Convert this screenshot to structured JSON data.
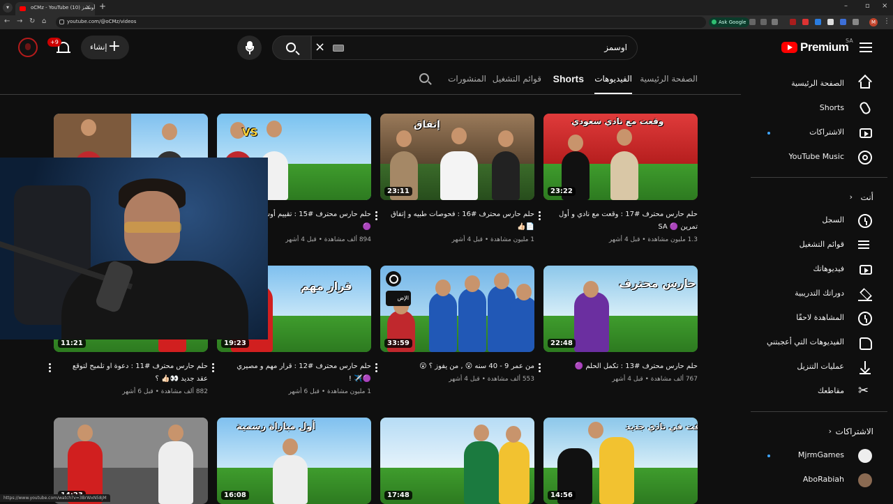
{
  "browser": {
    "tab_title": "oCMz - YouTube أوسمز (10)",
    "url": "youtube.com/@oCMz/videos",
    "ask_google": "Ask Google",
    "profile_initial": "M",
    "status_url": "https://www.youtube.com/watch?v=3BrWxN58jM"
  },
  "header": {
    "logo_word": "Premium",
    "country_code": "SA",
    "search_query": "اوسمز",
    "create_label": "إنشاء",
    "notification_count": "+9"
  },
  "channel_tabs": [
    {
      "label": "الصفحة الرئيسية",
      "active": false
    },
    {
      "label": "الفيديوهات",
      "active": true
    },
    {
      "label": "Shorts",
      "active": false
    },
    {
      "label": "قوائم التشغيل",
      "active": false
    },
    {
      "label": "المنشورات",
      "active": false
    }
  ],
  "sidebar": {
    "main": [
      {
        "label": "الصفحة الرئيسية",
        "icon": "home-icon"
      },
      {
        "label": "Shorts",
        "icon": "shorts-icon"
      },
      {
        "label": "الاشتراكات",
        "icon": "subscriptions-icon",
        "new": true
      },
      {
        "label": "YouTube Music",
        "icon": "youtube-music-icon"
      }
    ],
    "you_heading": "أنت",
    "you": [
      {
        "label": "السجل",
        "icon": "history-icon"
      },
      {
        "label": "قوائم التشغيل",
        "icon": "playlists-icon"
      },
      {
        "label": "فيديوهاتك",
        "icon": "your-videos-icon"
      },
      {
        "label": "دوراتك التدريبية",
        "icon": "courses-icon"
      },
      {
        "label": "المشاهدة لاحقًا",
        "icon": "watch-later-icon"
      },
      {
        "label": "الفيديوهات التي أعجبتني",
        "icon": "liked-icon"
      },
      {
        "label": "عمليات التنزيل",
        "icon": "downloads-icon"
      },
      {
        "label": "مقاطعك",
        "icon": "clips-icon"
      }
    ],
    "subs_heading": "الاشتراكات",
    "subs": [
      {
        "label": "MjrmGames",
        "new": true
      },
      {
        "label": "AboRabiah",
        "new": false
      }
    ]
  },
  "videos": [
    {
      "title": "حلم حارس محترف #17 : وقعت مع نادي و أول تمرين 🟣 SA",
      "meta": "1.3 مليون مشاهدة • قبل 4 أشهر",
      "duration": "23:22",
      "caption": "وقعت مع نادي سعودي"
    },
    {
      "title": "حلم حارس محترف #16 : فحوصات طبيه و إتفاق 📄👍🏻",
      "meta": "1 مليون مشاهدة • قبل 4 أشهر",
      "duration": "23:11",
      "caption": "إتفاق"
    },
    {
      "title": "حلم حارس محترف #15 : تقييم أوسمز عربي ⚽🟣",
      "meta": "894 ألف مشاهدة • قبل 4 أشهر",
      "duration": "",
      "caption": "VS"
    },
    {
      "title": "",
      "meta": "",
      "duration": "",
      "caption": ""
    },
    {
      "title": "حلم حارس محترف #13 : تكمل الحلم 🟣",
      "meta": "767 ألف مشاهدة • قبل 4 أشهر",
      "duration": "22:48",
      "caption": "حلم حارس محترف"
    },
    {
      "title": "من عمر 9 - 40 سنه 😮 , من يفوز ؟ 😮",
      "meta": "553 ألف مشاهدة • قبل 4 أشهر",
      "duration": "33:59",
      "caption": "",
      "queue_label": "الإض"
    },
    {
      "title": "حلم حارس محترف #12 : قرار مهم و مصيري 🟣✈️ !",
      "meta": "1 مليون مشاهدة • قبل 6 أشهر",
      "duration": "19:23",
      "caption": "قرار مهم"
    },
    {
      "title": "حلم حارس محترف #11 : دعوة او تلميح لتوقع عقد جديد 👀👍🏻 ؟",
      "meta": "882 ألف مشاهدة • قبل 6 أشهر",
      "duration": "11:21",
      "caption": ""
    },
    {
      "title": "",
      "meta": "",
      "duration": "14:56",
      "caption": "احترفت في نادي جديد"
    },
    {
      "title": "",
      "meta": "",
      "duration": "17:48",
      "caption": ""
    },
    {
      "title": "",
      "meta": "",
      "duration": "16:08",
      "caption": "أول مباراة رسمية"
    },
    {
      "title": "",
      "meta": "",
      "duration": "14:23",
      "caption": ""
    }
  ]
}
